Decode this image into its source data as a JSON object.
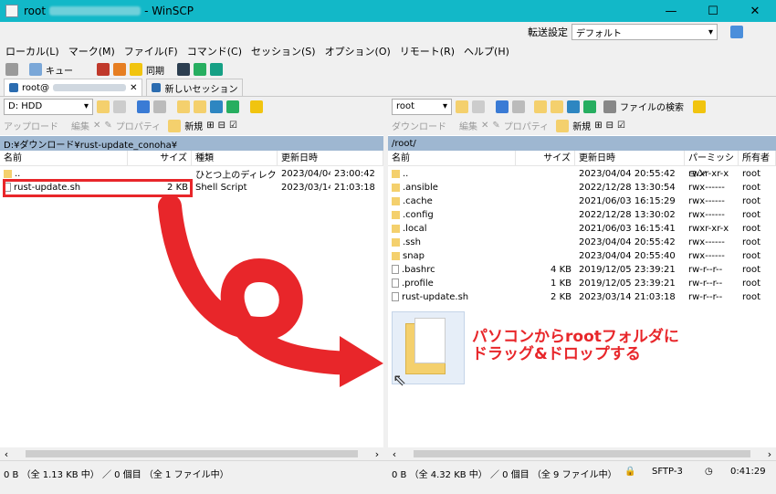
{
  "window": {
    "title_left": "root",
    "title_right": " - WinSCP",
    "min": "—",
    "max": "☐",
    "close": "✕"
  },
  "transfer": {
    "label": "転送設定",
    "value": "デフォルト"
  },
  "menu": [
    "ローカル(L)",
    "マーク(M)",
    "ファイル(F)",
    "コマンド(C)",
    "セッション(S)",
    "オプション(O)",
    "リモート(R)",
    "ヘルプ(H)"
  ],
  "toolbar": {
    "queue": "キュー",
    "sync": "同期"
  },
  "tabs": {
    "session": "root@",
    "new": "新しいセッション"
  },
  "left": {
    "drive": "D: HDD",
    "upload": "アップロード",
    "edit": "編集",
    "props": "プロパティ",
    "new": "新規",
    "path": "D:¥ダウンロード¥rust-update_conoha¥",
    "cols": [
      "名前",
      "サイズ",
      "種類",
      "更新日時"
    ],
    "rows": [
      {
        "name": "..",
        "size": "",
        "type": "ひとつ上のディレクトリ",
        "date": "2023/04/04",
        "time": "23:00:42"
      },
      {
        "name": "rust-update.sh",
        "size": "2 KB",
        "type": "Shell Script",
        "date": "2023/03/14",
        "time": "21:03:18"
      }
    ],
    "status": "0 B （全 1.13 KB 中） ／ 0 個目 （全 1 ファイル中）"
  },
  "right": {
    "drive": "root",
    "find": "ファイルの検索",
    "download": "ダウンロード",
    "edit": "編集",
    "props": "プロパティ",
    "new": "新規",
    "path": "/root/",
    "cols": [
      "名前",
      "サイズ",
      "更新日時",
      "パーミッション",
      "所有者"
    ],
    "rows": [
      {
        "name": "..",
        "size": "",
        "date": "2023/04/04 20:55:42",
        "perm": "rwxr-xr-x",
        "owner": "root"
      },
      {
        "name": ".ansible",
        "size": "",
        "date": "2022/12/28 13:30:54",
        "perm": "rwx------",
        "owner": "root"
      },
      {
        "name": ".cache",
        "size": "",
        "date": "2021/06/03 16:15:29",
        "perm": "rwx------",
        "owner": "root"
      },
      {
        "name": ".config",
        "size": "",
        "date": "2022/12/28 13:30:02",
        "perm": "rwx------",
        "owner": "root"
      },
      {
        "name": ".local",
        "size": "",
        "date": "2021/06/03 16:15:41",
        "perm": "rwxr-xr-x",
        "owner": "root"
      },
      {
        "name": ".ssh",
        "size": "",
        "date": "2023/04/04 20:55:42",
        "perm": "rwx------",
        "owner": "root"
      },
      {
        "name": "snap",
        "size": "",
        "date": "2023/04/04 20:55:40",
        "perm": "rwx------",
        "owner": "root"
      },
      {
        "name": ".bashrc",
        "size": "4 KB",
        "date": "2019/12/05 23:39:21",
        "perm": "rw-r--r--",
        "owner": "root"
      },
      {
        "name": ".profile",
        "size": "1 KB",
        "date": "2019/12/05 23:39:21",
        "perm": "rw-r--r--",
        "owner": "root"
      },
      {
        "name": "rust-update.sh",
        "size": "2 KB",
        "date": "2023/03/14 21:03:18",
        "perm": "rw-r--r--",
        "owner": "root"
      }
    ],
    "status": "0 B （全 4.32 KB 中） ／ 0 個目 （全 9 ファイル中）"
  },
  "statusbar": {
    "proto": "SFTP-3",
    "time": "0:41:29"
  },
  "annotation": {
    "line1": "パソコンからrootフォルダに",
    "line2": "ドラッグ&ドロップする"
  },
  "colors": {
    "titlebar": "#12b8c8",
    "path": "#9eb7d1",
    "accent_red": "#e8262a"
  }
}
